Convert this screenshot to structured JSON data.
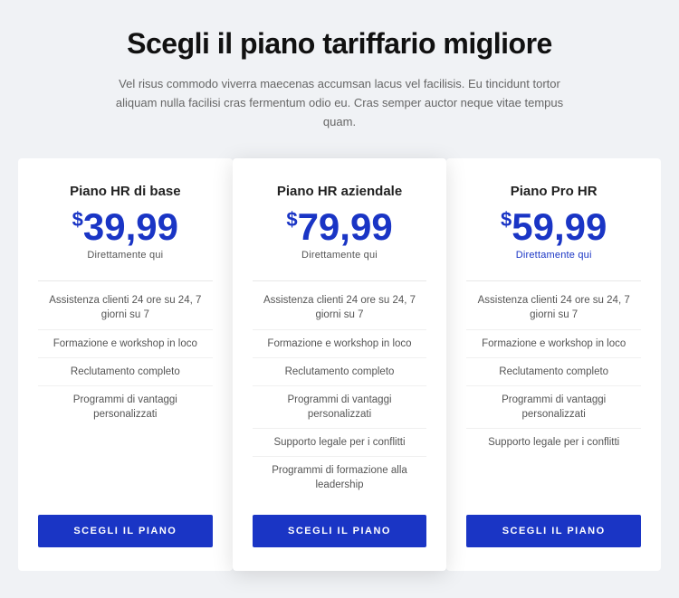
{
  "header": {
    "title": "Scegli il piano tariffario migliore",
    "subtitle": "Vel risus commodo viverra maecenas accumsan lacus vel facilisis. Eu tincidunt tortor aliquam nulla facilisi cras fermentum odio eu. Cras semper auctor neque vitae tempus quam."
  },
  "plans": [
    {
      "id": "base",
      "name": "Piano HR di base",
      "price_symbol": "$",
      "price": "39,99",
      "cta_text": "Direttamente qui",
      "cta_blue": false,
      "featured": false,
      "features": [
        "Assistenza clienti 24 ore su 24, 7 giorni su 7",
        "Formazione e workshop in loco",
        "Reclutamento completo",
        "Programmi di vantaggi personalizzati"
      ],
      "button_label": "SCEGLI IL PIANO"
    },
    {
      "id": "aziendale",
      "name": "Piano HR aziendale",
      "price_symbol": "$",
      "price": "79,99",
      "cta_text": "Direttamente qui",
      "cta_blue": false,
      "featured": true,
      "features": [
        "Assistenza clienti 24 ore su 24, 7 giorni su 7",
        "Formazione e workshop in loco",
        "Reclutamento completo",
        "Programmi di vantaggi personalizzati",
        "Supporto legale per i conflitti",
        "Programmi di formazione alla leadership"
      ],
      "button_label": "SCEGLI IL PIANO"
    },
    {
      "id": "pro",
      "name": "Piano Pro HR",
      "price_symbol": "$",
      "price": "59,99",
      "cta_text": "Direttamente qui",
      "cta_blue": true,
      "featured": false,
      "features": [
        "Assistenza clienti 24 ore su 24, 7 giorni su 7",
        "Formazione e workshop in loco",
        "Reclutamento completo",
        "Programmi di vantaggi personalizzati",
        "Supporto legale per i conflitti"
      ],
      "button_label": "SCEGLI IL PIANO"
    }
  ]
}
